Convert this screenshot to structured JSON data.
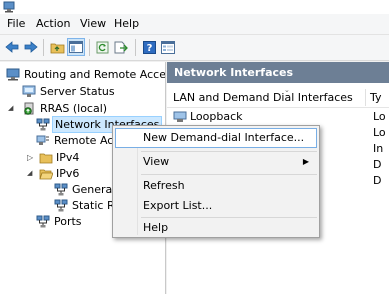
{
  "menu": [
    "File",
    "Action",
    "View",
    "Help"
  ],
  "tree": {
    "root": "Routing and Remote Access",
    "server_status": "Server Status",
    "server": "RRAS (local)",
    "network_interfaces": "Network Interfaces",
    "remote_access": "Remote Acce",
    "ipv4": "IPv4",
    "ipv6": "IPv6",
    "general": "General",
    "static_routes": "Static Ro",
    "ports": "Ports"
  },
  "right_panel": {
    "header": "Network Interfaces",
    "col_interfaces": "LAN and Demand Dial Interfaces",
    "col_type": "Ty",
    "rows": [
      {
        "name": "Loopback",
        "type": "Lo"
      },
      {
        "name": "",
        "type": "Lo"
      },
      {
        "name": "",
        "type": "In"
      },
      {
        "name": "",
        "type": "D"
      },
      {
        "name": "",
        "type": "D"
      }
    ]
  },
  "context_menu": {
    "new_demand_dial": "New Demand-dial Interface...",
    "view": "View",
    "refresh": "Refresh",
    "export_list": "Export List...",
    "help": "Help"
  }
}
